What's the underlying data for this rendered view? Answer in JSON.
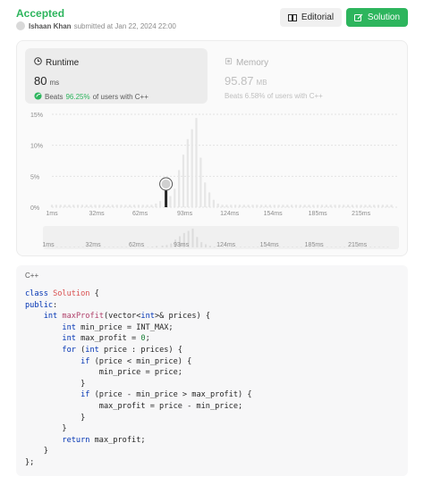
{
  "header": {
    "status": "Accepted",
    "user": "Ishaan Khan",
    "submitted_text": "submitted at Jan 22, 2024 22:00",
    "editorial_label": "Editorial",
    "solution_label": "Solution"
  },
  "runtime": {
    "title": "Runtime",
    "value": "80",
    "unit": "ms",
    "beats_prefix": "Beats",
    "beats_pct": "96.25%",
    "beats_suffix": "of users with C++"
  },
  "memory": {
    "title": "Memory",
    "value": "95.87",
    "unit": "MB",
    "beats_text": "Beats 6.58% of users with C++"
  },
  "chart_data": {
    "type": "bar",
    "title": "",
    "xlabel": "",
    "ylabel": "",
    "y_ticks": [
      "15%",
      "10%",
      "5%",
      "0%"
    ],
    "ylim": [
      0,
      15
    ],
    "x_ticks": [
      "1ms",
      "32ms",
      "62ms",
      "93ms",
      "124ms",
      "154ms",
      "185ms",
      "215ms"
    ],
    "xlim": [
      1,
      240
    ],
    "bin_width": 3.07,
    "grid": true,
    "bars": [
      {
        "x": 1,
        "y": 0.4
      },
      {
        "x": 4,
        "y": 0.4
      },
      {
        "x": 7,
        "y": 0.4
      },
      {
        "x": 10,
        "y": 0.4
      },
      {
        "x": 13,
        "y": 0.4
      },
      {
        "x": 16,
        "y": 0.4
      },
      {
        "x": 19,
        "y": 0.4
      },
      {
        "x": 22,
        "y": 0.4
      },
      {
        "x": 25,
        "y": 0.4
      },
      {
        "x": 28,
        "y": 0.4
      },
      {
        "x": 31,
        "y": 0.4
      },
      {
        "x": 34,
        "y": 0.4
      },
      {
        "x": 37,
        "y": 0.4
      },
      {
        "x": 40,
        "y": 0.4
      },
      {
        "x": 43,
        "y": 0.4
      },
      {
        "x": 46,
        "y": 0.4
      },
      {
        "x": 49,
        "y": 0.4
      },
      {
        "x": 52,
        "y": 0.4
      },
      {
        "x": 55,
        "y": 0.4
      },
      {
        "x": 58,
        "y": 0.4
      },
      {
        "x": 61,
        "y": 0.4
      },
      {
        "x": 64,
        "y": 0.4
      },
      {
        "x": 67,
        "y": 0.4
      },
      {
        "x": 70,
        "y": 0.4
      },
      {
        "x": 73,
        "y": 0.6
      },
      {
        "x": 76,
        "y": 1.0
      },
      {
        "x": 80,
        "y": 1.4
      },
      {
        "x": 83,
        "y": 1.8
      },
      {
        "x": 86,
        "y": 3.0
      },
      {
        "x": 89,
        "y": 6.0
      },
      {
        "x": 92,
        "y": 8.5
      },
      {
        "x": 95,
        "y": 11.0
      },
      {
        "x": 98,
        "y": 12.6
      },
      {
        "x": 101,
        "y": 14.4
      },
      {
        "x": 104,
        "y": 8.0
      },
      {
        "x": 107,
        "y": 4.0
      },
      {
        "x": 110,
        "y": 2.4
      },
      {
        "x": 113,
        "y": 1.2
      },
      {
        "x": 116,
        "y": 0.6
      },
      {
        "x": 119,
        "y": 0.4
      },
      {
        "x": 122,
        "y": 0.4
      },
      {
        "x": 125,
        "y": 0.4
      },
      {
        "x": 128,
        "y": 0.4
      },
      {
        "x": 131,
        "y": 0.4
      },
      {
        "x": 134,
        "y": 0.4
      },
      {
        "x": 137,
        "y": 0.4
      },
      {
        "x": 140,
        "y": 0.4
      },
      {
        "x": 143,
        "y": 0.4
      },
      {
        "x": 146,
        "y": 0.4
      },
      {
        "x": 149,
        "y": 0.4
      },
      {
        "x": 152,
        "y": 0.4
      },
      {
        "x": 155,
        "y": 0.4
      },
      {
        "x": 158,
        "y": 0.4
      },
      {
        "x": 161,
        "y": 0.4
      },
      {
        "x": 164,
        "y": 0.4
      },
      {
        "x": 167,
        "y": 0.4
      },
      {
        "x": 170,
        "y": 0.4
      },
      {
        "x": 173,
        "y": 0.4
      },
      {
        "x": 176,
        "y": 0.4
      },
      {
        "x": 179,
        "y": 0.4
      },
      {
        "x": 182,
        "y": 0.4
      },
      {
        "x": 185,
        "y": 0.4
      },
      {
        "x": 188,
        "y": 0.4
      },
      {
        "x": 191,
        "y": 0.4
      },
      {
        "x": 194,
        "y": 0.4
      },
      {
        "x": 197,
        "y": 0.4
      },
      {
        "x": 200,
        "y": 0.4
      },
      {
        "x": 203,
        "y": 0.4
      },
      {
        "x": 206,
        "y": 0.4
      },
      {
        "x": 209,
        "y": 0.4
      },
      {
        "x": 212,
        "y": 0.4
      },
      {
        "x": 215,
        "y": 0.4
      },
      {
        "x": 218,
        "y": 0.4
      },
      {
        "x": 221,
        "y": 0.4
      },
      {
        "x": 224,
        "y": 0.4
      },
      {
        "x": 227,
        "y": 0.4
      },
      {
        "x": 230,
        "y": 0.4
      },
      {
        "x": 233,
        "y": 0.4
      },
      {
        "x": 236,
        "y": 0.4
      }
    ],
    "highlight_x": 80,
    "highlight_y": 1.4
  },
  "code": {
    "language": "C++"
  },
  "colors": {
    "accent": "#2db55d",
    "bar": "#e6e6e6",
    "bar_highlight": "#262626"
  }
}
